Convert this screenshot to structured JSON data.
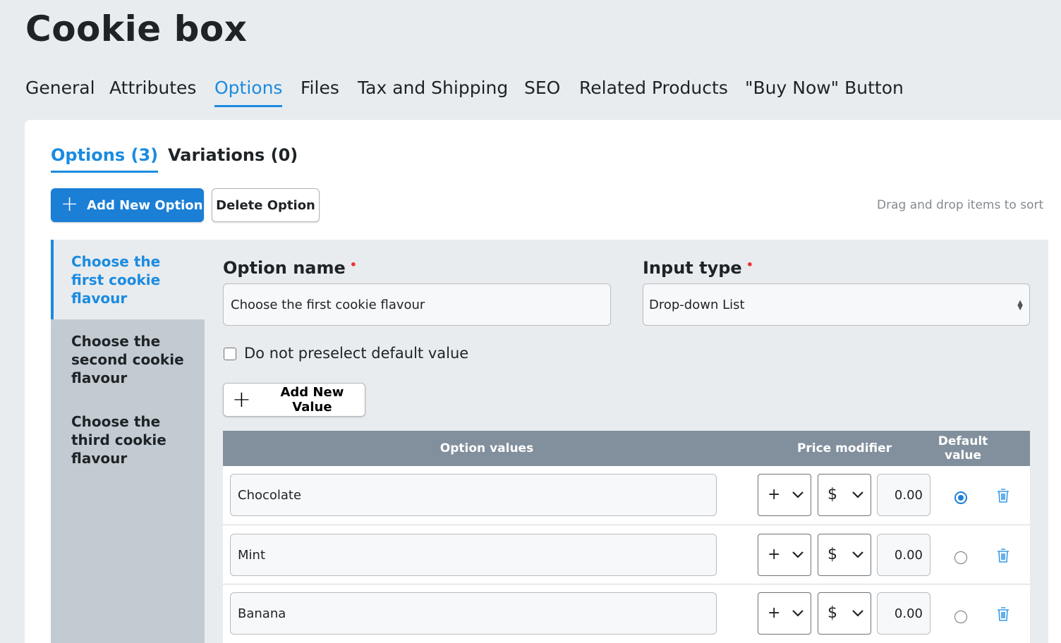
{
  "page": {
    "title": "Cookie box"
  },
  "main_tabs": [
    {
      "label": "General"
    },
    {
      "label": "Attributes"
    },
    {
      "label": "Options",
      "active": true
    },
    {
      "label": "Files"
    },
    {
      "label": "Tax and Shipping"
    },
    {
      "label": "SEO"
    },
    {
      "label": "Related Products"
    },
    {
      "label": "\"Buy Now\" Button"
    }
  ],
  "sub_tabs": [
    {
      "label": "Options (3)",
      "active": true
    },
    {
      "label": "Variations (0)"
    }
  ],
  "toolbar": {
    "add_option_label": "Add New Option",
    "delete_option_label": "Delete Option",
    "drag_hint": "Drag and drop items to sort"
  },
  "options_list": [
    {
      "label": "Choose the first cookie flavour",
      "active": true
    },
    {
      "label": "Choose the second cookie flavour"
    },
    {
      "label": "Choose the third cookie flavour"
    }
  ],
  "form": {
    "option_name_label": "Option name",
    "option_name_value": "Choose the first cookie flavour",
    "input_type_label": "Input type",
    "input_type_value": "Drop-down List",
    "required_marker": "•",
    "preselect_label": "Do not preselect default value",
    "preselect_checked": false,
    "add_value_label": "Add New Value"
  },
  "values_table": {
    "headers": {
      "option_values": "Option values",
      "price_modifier": "Price modifier",
      "default_value": "Default value"
    },
    "rows": [
      {
        "value": "Chocolate",
        "sign": "+",
        "currency": "$",
        "price": "0.00",
        "default": true
      },
      {
        "value": "Mint",
        "sign": "+",
        "currency": "$",
        "price": "0.00",
        "default": false
      },
      {
        "value": "Banana",
        "sign": "+",
        "currency": "$",
        "price": "0.00",
        "default": false
      }
    ]
  },
  "colors": {
    "accent": "#1b8be0",
    "primary_button": "#1b7fd6",
    "table_header": "#828f9d",
    "background": "#e9ecef"
  }
}
